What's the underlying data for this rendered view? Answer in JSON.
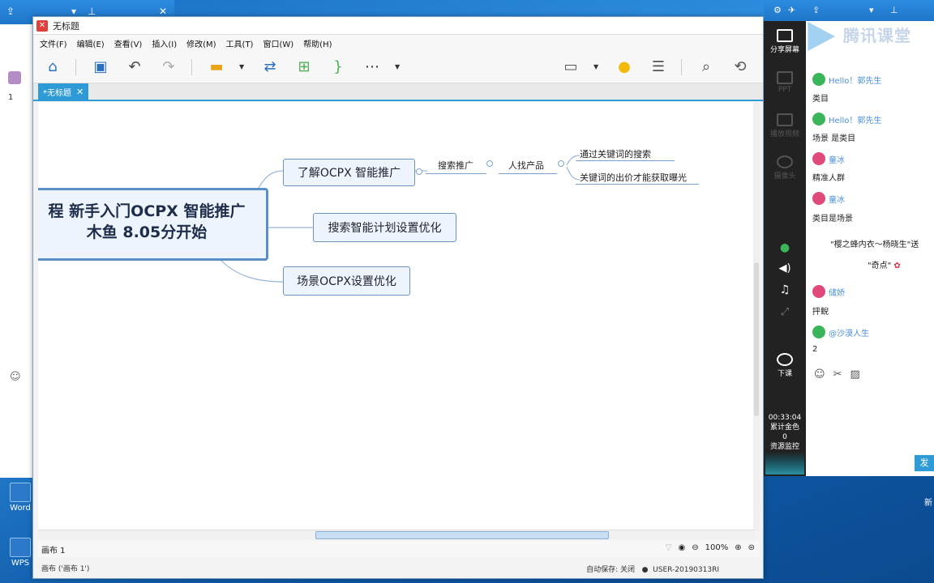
{
  "background_left": {
    "line_number": "1"
  },
  "desktop": {
    "word_label": "Word",
    "wps_label": "WPS",
    "right_label": "新"
  },
  "window": {
    "title": "无标题",
    "menu": [
      "文件(F)",
      "编辑(E)",
      "查看(V)",
      "插入(I)",
      "修改(M)",
      "工具(T)",
      "窗口(W)",
      "帮助(H)"
    ],
    "tab_label": "*无标题",
    "mindmap": {
      "root_line1": "程 新手入门OCPX 智能推广",
      "root_line2": "木鱼 8.05分开始",
      "topic1": "了解OCPX 智能推广",
      "topic2": "搜索智能计划设置优化",
      "topic3": "场景OCPX设置优化",
      "sub_search": "搜索推广",
      "sub_people": "人找产品",
      "sub_kw": "通过关键词的搜索",
      "sub_price": "关键词的出价才能获取曝光"
    },
    "status": {
      "canvas": "画布 1",
      "zoom": "100%"
    },
    "bottom": {
      "canvas_info": "画布 ('画布 1')",
      "autosave": "自动保存: 关闭",
      "user": "USER-20190313RI"
    }
  },
  "tencent": {
    "logo": "腾讯课堂",
    "sidebar": [
      "分享屏幕",
      "PPT",
      "播放视频",
      "摄像头",
      "下课"
    ],
    "timer": "00:33:04",
    "gift_label": "累计金色",
    "gift_count": "0",
    "monitor": "资源监控",
    "messages": [
      {
        "name": "Hello！郭先生",
        "text": "类目",
        "color": "#3bb55a"
      },
      {
        "name": "Hello！郭先生",
        "text": "场景 是类目",
        "color": "#3bb55a"
      },
      {
        "name": "童冰",
        "text": "精准人群",
        "color": "#e04a7a"
      },
      {
        "name": "童冰",
        "text": "类目是场景",
        "color": "#e04a7a"
      },
      {
        "name": "储娇",
        "text": "抨鲵",
        "color": "#e04a7a"
      },
      {
        "name": "@沙漠人生",
        "text": "2",
        "color": "#3bb55a"
      }
    ],
    "gift_msg1": "\"樱之蜂内衣～杨晓生\"送",
    "gift_msg2": "\"奇点\"",
    "send": "发"
  }
}
